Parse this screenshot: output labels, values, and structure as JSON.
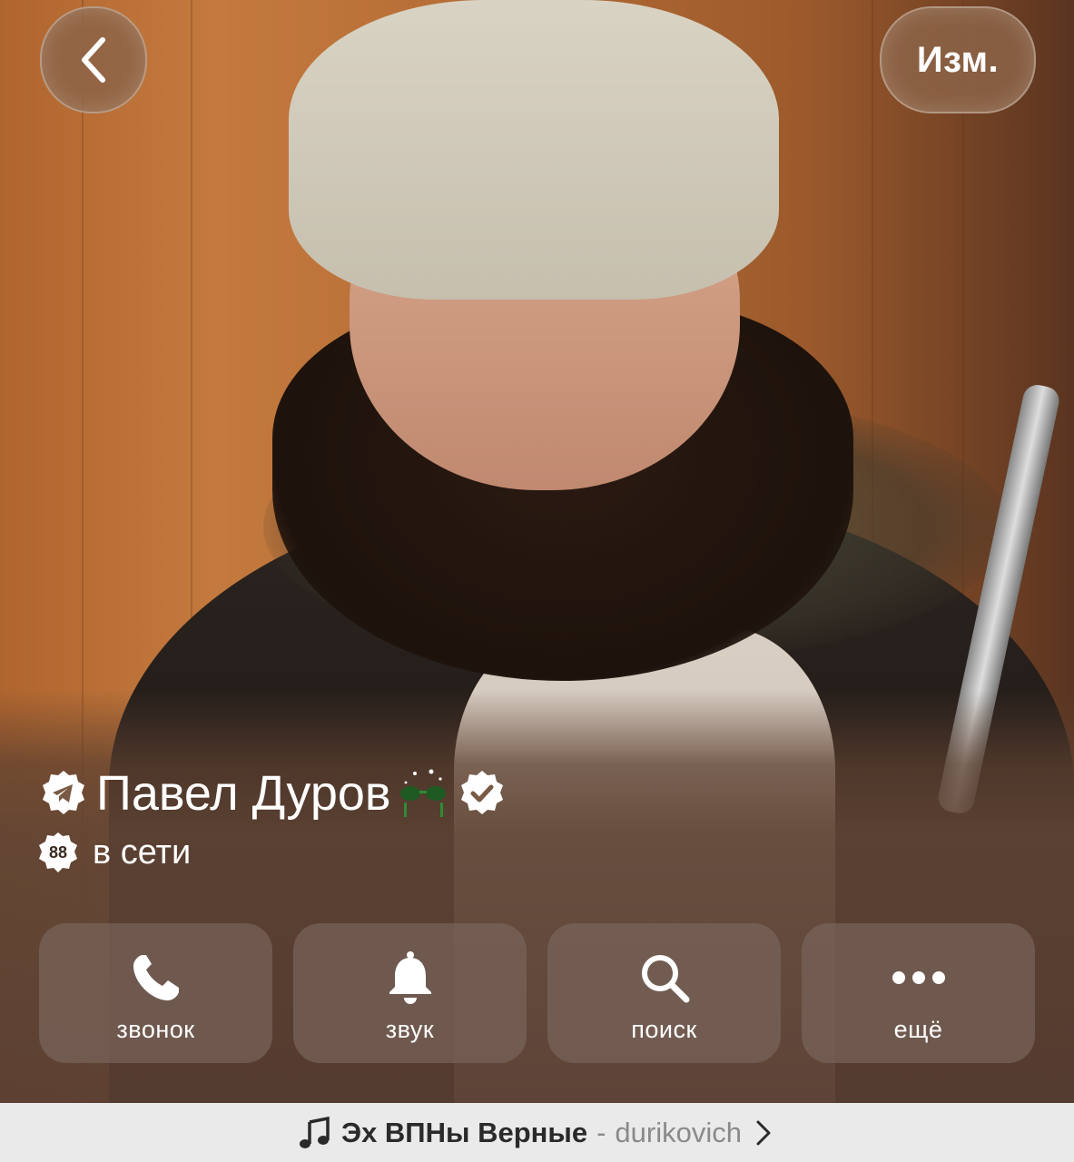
{
  "header": {
    "back_icon": "chevron-left-icon",
    "edit_label": "Изм."
  },
  "profile": {
    "name": "Павел Дуров",
    "status": "в сети",
    "level_badge": "88",
    "verified": true
  },
  "actions": [
    {
      "icon": "phone-icon",
      "label": "звонок"
    },
    {
      "icon": "bell-icon",
      "label": "звук"
    },
    {
      "icon": "search-icon",
      "label": "поиск"
    },
    {
      "icon": "more-icon",
      "label": "ещё"
    }
  ],
  "music": {
    "icon": "music-note-icon",
    "title": "Эх ВПНы Верные",
    "separator": "-",
    "artist": "durikovich"
  },
  "colors": {
    "bar_background": "#eaeaea",
    "verified_badge": "#ffffff"
  }
}
